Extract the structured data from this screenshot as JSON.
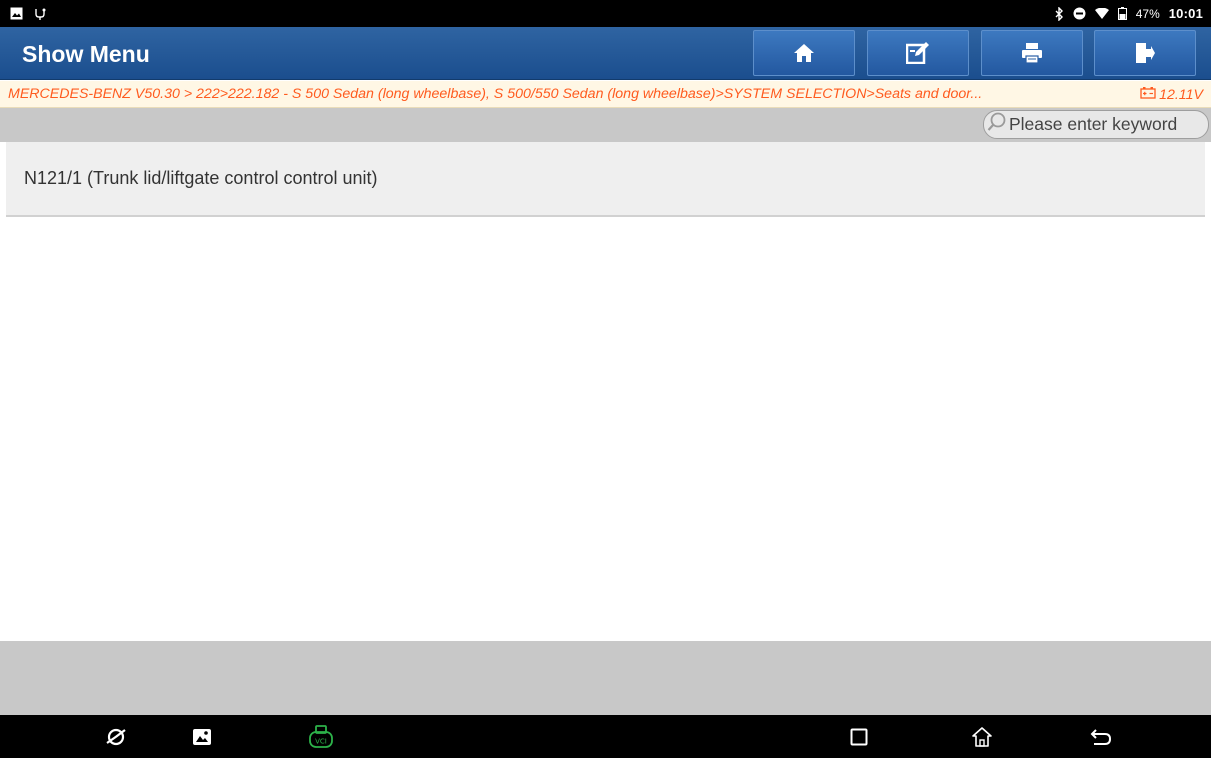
{
  "status_bar": {
    "left_icons": [
      "gallery-icon",
      "usb-debug-icon"
    ],
    "right_icons": [
      "bluetooth-icon",
      "do-not-disturb-icon",
      "wifi-icon",
      "battery-icon"
    ],
    "battery": "47%",
    "time": "10:01"
  },
  "header": {
    "title": "Show Menu",
    "buttons": [
      "home-icon",
      "edit-report-icon",
      "print-icon",
      "exit-icon"
    ]
  },
  "breadcrumb": {
    "path": "MERCEDES-BENZ V50.30 > 222>222.182 - S 500 Sedan (long wheelbase), S 500/550 Sedan (long wheelbase)>SYSTEM SELECTION>Seats and door...",
    "voltage": "12.11V"
  },
  "search": {
    "placeholder": "Please enter keyword"
  },
  "list": {
    "items": [
      {
        "label": "N121/1 (Trunk lid/liftgate control control unit)"
      }
    ]
  },
  "nav_bar": {
    "left_icons": [
      "browser-icon",
      "gallery-icon",
      "vci-icon"
    ],
    "right_icons": [
      "recents-icon",
      "home-icon",
      "back-icon"
    ]
  },
  "colors": {
    "header_blue": "#1f5596",
    "breadcrumb_text": "#ff5b1f",
    "vci_green": "#2db34a"
  }
}
